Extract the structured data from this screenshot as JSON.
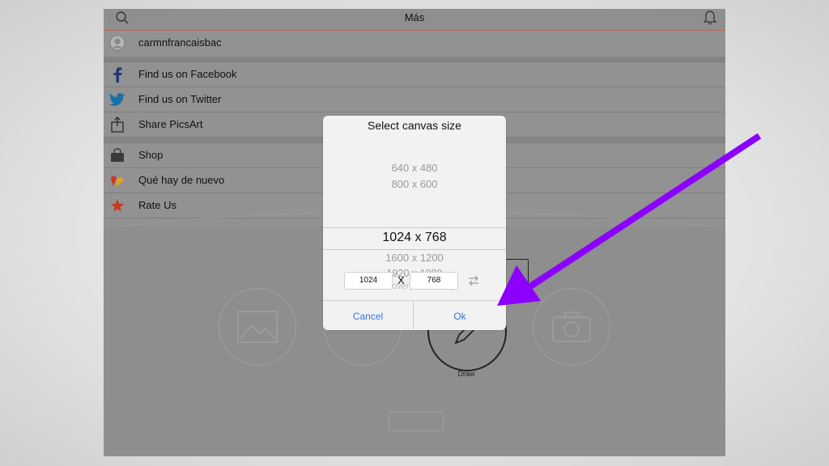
{
  "nav": {
    "title": "Más"
  },
  "menu": {
    "user": "carmnfrancaisbac",
    "items_group1": [
      {
        "label": "Find us on Facebook",
        "icon": "facebook-icon"
      },
      {
        "label": "Find us on Twitter",
        "icon": "twitter-icon"
      },
      {
        "label": "Share PicsArt",
        "icon": "share-icon"
      }
    ],
    "items_group2": [
      {
        "label": "Shop",
        "icon": "shop-bag-icon"
      },
      {
        "label": "Qué hay de nuevo",
        "icon": "whats-new-icon"
      },
      {
        "label": "Rate Us",
        "icon": "star-icon"
      }
    ]
  },
  "background": {
    "draw_label": "Draw"
  },
  "dialog": {
    "title": "Select canvas size",
    "options": [
      "640 x 480",
      "800 x 600",
      "1024 x 768",
      "1600 x 1200",
      "1920 x 1080",
      "Fb cover(851 x 315)"
    ],
    "selected": "1024 x 768",
    "width_value": "1024",
    "height_value": "768",
    "x_label": "X",
    "cancel_label": "Cancel",
    "ok_label": "Ok"
  },
  "colors": {
    "accent_blue": "#3b72d9",
    "arrow_purple": "#8b00ff",
    "facebook": "#3b5998",
    "twitter": "#1da1f2",
    "star": "#e2452c"
  }
}
